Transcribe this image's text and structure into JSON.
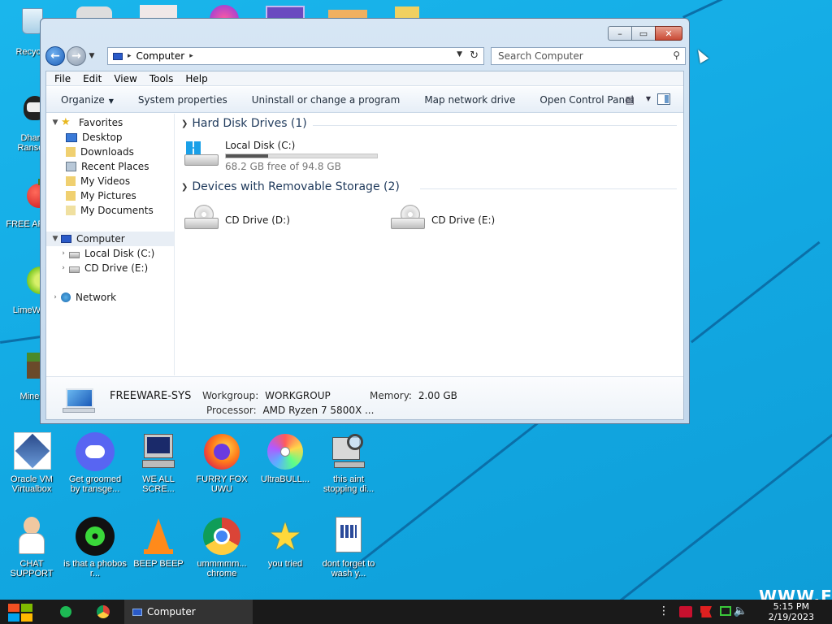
{
  "desktop_icons": [
    {
      "label": "Recycle"
    },
    {
      "label": "Dharm Ransom"
    },
    {
      "label": "FREE APPLE"
    },
    {
      "label": "LimeWire"
    },
    {
      "label": "Minecr"
    },
    {
      "label": "Oracle VM Virtualbox"
    },
    {
      "label": "Get groomed by transge..."
    },
    {
      "label": "WE ALL SCRE..."
    },
    {
      "label": "FURRY FOX UWU"
    },
    {
      "label": "UltraBULL..."
    },
    {
      "label": "this aint stopping di..."
    },
    {
      "label": "CHAT SUPPORT"
    },
    {
      "label": "is that a phobos r..."
    },
    {
      "label": "BEEP BEEP"
    },
    {
      "label": "ummmmm... chrome"
    },
    {
      "label": "you tried"
    },
    {
      "label": "dont forget to wash y..."
    }
  ],
  "window": {
    "caption_buttons": {
      "minimize": "–",
      "maximize": "▭",
      "close": "✕"
    },
    "address": {
      "segment": "Computer"
    },
    "search_placeholder": "Search Computer",
    "menu": [
      "File",
      "Edit",
      "View",
      "Tools",
      "Help"
    ],
    "commands": {
      "organize": "Organize",
      "system_properties": "System properties",
      "uninstall": "Uninstall or change a program",
      "map_drive": "Map network drive",
      "control_panel": "Open Control Panel"
    },
    "nav": {
      "favorites": "Favorites",
      "desktop": "Desktop",
      "downloads": "Downloads",
      "recent": "Recent Places",
      "videos": "My Videos",
      "pictures": "My Pictures",
      "documents": "My Documents",
      "computer": "Computer",
      "local_disk": "Local Disk (C:)",
      "cd_drive": "CD Drive (E:)",
      "network": "Network"
    },
    "groups": {
      "hdd": "Hard Disk Drives (1)",
      "removable": "Devices with Removable Storage (2)"
    },
    "drives": {
      "c_name": "Local Disk (C:)",
      "c_free": "68.2 GB free of 94.8 GB",
      "c_used_fraction": 0.28,
      "d_name": "CD Drive (D:)",
      "e_name": "CD Drive (E:)"
    },
    "details": {
      "pc_name": "FREEWARE-SYS",
      "workgroup_label": "Workgroup:",
      "workgroup": "WORKGROUP",
      "memory_label": "Memory:",
      "memory": "2.00 GB",
      "processor_label": "Processor:",
      "processor": "AMD Ryzen 7 5800X ..."
    }
  },
  "taskbar": {
    "task_label": "Computer",
    "time": "5:15 PM",
    "date": "2/19/2023"
  },
  "watermark": "WWW.FR"
}
